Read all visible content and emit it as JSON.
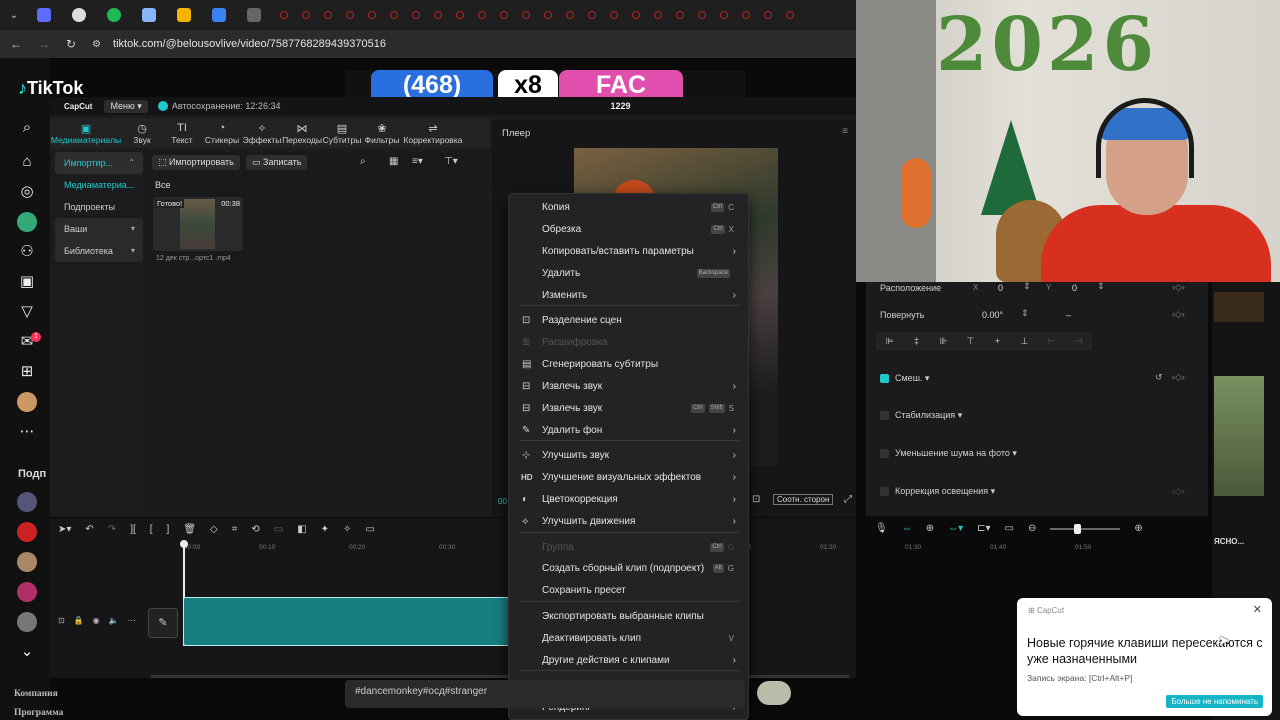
{
  "browser": {
    "url": "tiktok.com/@belousovlive/video/7587768289439370516"
  },
  "tiktok": {
    "logo": "TikTok",
    "suggest_label": "Подп",
    "footer": [
      "Компания",
      "Программа"
    ],
    "hashtags": "#dancemonkey#осд#stranger",
    "badge_count": "1"
  },
  "stream_overlay": {
    "counter": "(468)",
    "mult": "x8",
    "tag": "FAC",
    "num": "1229"
  },
  "capcut": {
    "brand": "CapCut",
    "menu": "Меню",
    "autosave": "Автосохранение: 12:26:34",
    "tools": [
      {
        "label": "Медиаматериалы",
        "icon": "media-icon"
      },
      {
        "label": "Звук",
        "icon": "audio-icon"
      },
      {
        "label": "Текст",
        "icon": "text-icon"
      },
      {
        "label": "Стикеры",
        "icon": "sticker-icon"
      },
      {
        "label": "Эффекты",
        "icon": "effects-icon"
      },
      {
        "label": "Переходы",
        "icon": "transitions-icon"
      },
      {
        "label": "Субтитры",
        "icon": "captions-icon"
      },
      {
        "label": "Фильтры",
        "icon": "filters-icon"
      },
      {
        "label": "Корректировка",
        "icon": "adjust-icon"
      }
    ],
    "nav": [
      "Импортир...",
      "Медиаматериа...",
      "Подпроекты",
      "Ваши",
      "Библиотека"
    ],
    "import_btn": "Импортировать",
    "record_btn": "Записать",
    "filter_all": "Все",
    "clip": {
      "status": "Готово!",
      "duration": "00:38",
      "filename": "12 дек стр...ортс1 .mp4"
    },
    "player_title": "Плеер",
    "aspect_btn": "Соотн. сторон",
    "accent": "#1fc9c9"
  },
  "timeline": {
    "ticks": [
      "00:00",
      "00:10",
      "00:20",
      "00:30",
      "01:00",
      "01:10",
      "01:20",
      "01:30",
      "01:40",
      "01:50"
    ]
  },
  "props": {
    "position_label": "Расположение",
    "pos_x_label": "X",
    "pos_x": "0",
    "pos_y_label": "Y",
    "pos_y": "0",
    "rotate_label": "Повернуть",
    "rotate": "0.00°",
    "rotate_dash": "–",
    "blend_label": "Смеш.",
    "stab_label": "Стабилизация",
    "noise_label": "Уменьшение шума на фото",
    "light_label": "Коррекция освещения"
  },
  "context_menu": {
    "items": [
      {
        "label": "Копия",
        "shortcut_mod": "Ctrl",
        "shortcut": "C",
        "enabled": true
      },
      {
        "label": "Обрезка",
        "shortcut_mod": "Ctrl",
        "shortcut": "X",
        "enabled": true
      },
      {
        "label": "Копировать/вставить параметры",
        "arrow": true,
        "enabled": true
      },
      {
        "label": "Удалить",
        "shortcut_mod": "Backspace",
        "enabled": true
      },
      {
        "label": "Изменить",
        "arrow": true,
        "enabled": true
      },
      {
        "label": "Разделение сцен",
        "icon": "scene-split-icon",
        "enabled": true
      },
      {
        "label": "Расшифровка",
        "icon": "transcript-icon",
        "enabled": false
      },
      {
        "label": "Сгенерировать субтитры",
        "icon": "subtitles-icon",
        "enabled": true
      },
      {
        "label": "Извлечь звук",
        "icon": "extract-audio-icon",
        "arrow": true,
        "enabled": true
      },
      {
        "label": "Извлечь звук",
        "icon": "extract-audio-2-icon",
        "shortcut_mod": "Ctrl Shift",
        "shortcut": "S",
        "enabled": true
      },
      {
        "label": "Удалить фон",
        "icon": "remove-bg-icon",
        "arrow": true,
        "enabled": true
      },
      {
        "label": "Улучшить звук",
        "icon": "enhance-audio-icon",
        "arrow": true,
        "enabled": true
      },
      {
        "label": "Улучшение визуальных эффектов",
        "icon": "hd-icon",
        "arrow": true,
        "enabled": true
      },
      {
        "label": "Цветокоррекция",
        "icon": "color-icon",
        "arrow": true,
        "enabled": true
      },
      {
        "label": "Улучшить движения",
        "icon": "motion-icon",
        "arrow": true,
        "enabled": true
      },
      {
        "label": "Группа",
        "shortcut_mod": "Ctrl",
        "shortcut": "G",
        "enabled": false
      },
      {
        "label": "Создать сборный клип (подпроект)",
        "shortcut_mod": "Alt",
        "shortcut": "G",
        "enabled": true
      },
      {
        "label": "Сохранить пресет",
        "enabled": true
      },
      {
        "label": "Экспортировать выбранные клипы",
        "enabled": true
      },
      {
        "label": "Деактивировать клип",
        "shortcut": "V",
        "enabled": true
      },
      {
        "label": "Другие действия с клипами",
        "arrow": true,
        "enabled": true
      },
      {
        "label": "Диапазон",
        "arrow": true,
        "enabled": true
      },
      {
        "label": "Рендеринг",
        "arrow": true,
        "enabled": true
      }
    ]
  },
  "notification": {
    "app": "CapCut",
    "title": "Новые горячие клавиши пересекаются с уже назначенными",
    "detail": "Запись экрана: [Ctrl+Alt+P]",
    "button": "Больше не напоминать"
  },
  "cam": {
    "year": "2026"
  },
  "right_strip": {
    "label": "ЯСНО..."
  }
}
